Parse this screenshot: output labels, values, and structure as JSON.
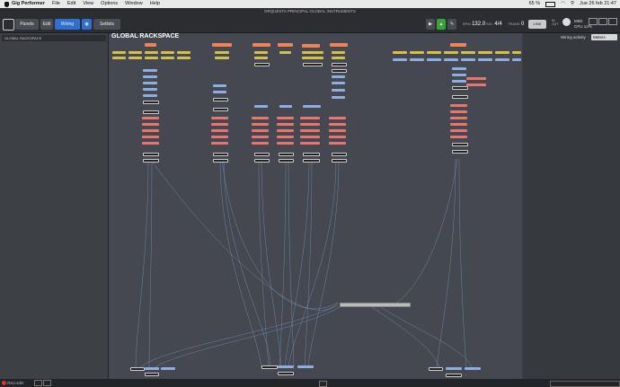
{
  "menubar": {
    "app_name": "Gig Performer",
    "items": [
      "File",
      "Edit",
      "View",
      "Options",
      "Window",
      "Help"
    ],
    "battery": "65 %",
    "datetime": "Jue 26 feb 21:47"
  },
  "window": {
    "title": "ORQUESTA PRINCIPAL GLOBAL INSTRUMENTS"
  },
  "toolbar": {
    "panels": "Panels",
    "edit": "Edit",
    "wiring": "Wiring",
    "setlists": "Setlists",
    "bpm_label": "BPM",
    "bpm": "132.0",
    "sig_label": "SIG.",
    "sig": "4/4",
    "trans_label": "TRANS",
    "trans": "0",
    "link": "LINK",
    "midi": "MIDI",
    "cpu_label": "CPU",
    "cpu": "12%"
  },
  "sidebar": {
    "items": [
      "GLOBAL RACKSPACE"
    ]
  },
  "main": {
    "title": "GLOBAL RACKSPACE"
  },
  "rightpanel": {
    "wiring_activity": "Wiring activity",
    "meters": "Meters"
  },
  "statusbar": {
    "recorder": "Recorder"
  }
}
